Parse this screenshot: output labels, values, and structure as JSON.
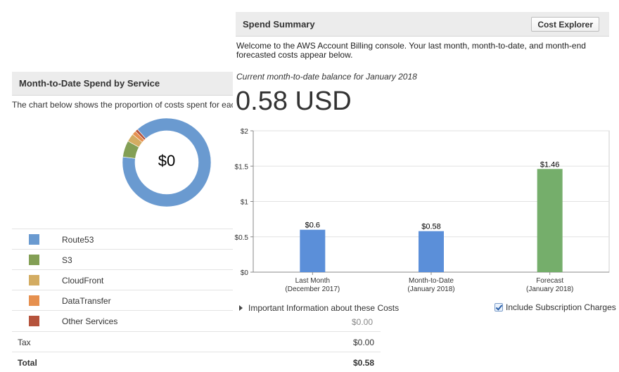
{
  "spend_by_service": {
    "title": "Month-to-Date Spend by Service",
    "description": "The chart below shows the proportion of costs spent for each se",
    "donut_center": "$0",
    "legend": [
      {
        "label": "Route53",
        "color": "#6a9ad0"
      },
      {
        "label": "S3",
        "color": "#839f55"
      },
      {
        "label": "CloudFront",
        "color": "#d3ac62"
      },
      {
        "label": "DataTransfer",
        "color": "#e6904f"
      },
      {
        "label": "Other Services",
        "color": "#b5533c"
      }
    ],
    "hidden_row_amount": "$0.00",
    "tax_label": "Tax",
    "tax_value": "$0.00",
    "total_label": "Total",
    "total_value": "$0.58"
  },
  "spend_summary": {
    "title": "Spend Summary",
    "cost_explorer_button": "Cost Explorer",
    "welcome_text": "Welcome to the AWS Account Billing console. Your last month, month-to-date, and month-end forecasted costs appear below.",
    "balance_label": "Current month-to-date balance for January 2018",
    "balance_value": "0.58 USD",
    "important_info_link": "Important Information about these Costs",
    "include_subscription_label": "Include Subscription Charges"
  },
  "chart_data": [
    {
      "type": "pie",
      "title": "",
      "center_label": "$0",
      "labels": [
        "Route53",
        "S3",
        "CloudFront",
        "DataTransfer",
        "Other Services"
      ],
      "values": [
        0.885,
        0.06,
        0.03,
        0.015,
        0.01
      ],
      "colors": [
        "#6a9ad0",
        "#839f55",
        "#d3ac62",
        "#e6904f",
        "#b5533c"
      ]
    },
    {
      "type": "bar",
      "categories": [
        "Last Month\n(December 2017)",
        "Month-to-Date\n(January 2018)",
        "Forecast\n(January 2018)"
      ],
      "values": [
        0.6,
        0.58,
        1.46
      ],
      "data_labels": [
        "$0.6",
        "$0.58",
        "$1.46"
      ],
      "colors": [
        "#5b8fd9",
        "#5b8fd9",
        "#75ae6b"
      ],
      "yticks": [
        "$0",
        "$0.5",
        "$1",
        "$1.5",
        "$2"
      ],
      "ytick_values": [
        0,
        0.5,
        1,
        1.5,
        2
      ],
      "ylim": [
        0,
        2
      ],
      "grid": true,
      "xlabel": "",
      "ylabel": ""
    }
  ]
}
